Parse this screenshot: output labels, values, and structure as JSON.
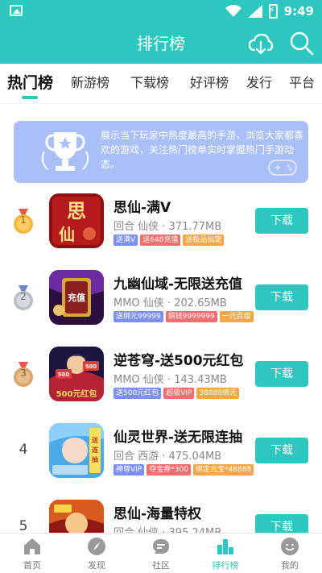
{
  "status_bar": {
    "time": "9:49"
  },
  "header": {
    "title": "排行榜"
  },
  "tabs": [
    {
      "label": "热门榜"
    },
    {
      "label": "新游榜"
    },
    {
      "label": "下载榜"
    },
    {
      "label": "好评榜"
    },
    {
      "label": "发行"
    },
    {
      "label": "平台"
    }
  ],
  "banner": {
    "text": "展示当下玩家中热度最高的手游，浏览大家都喜欢的游戏，关注热门榜单实时掌握热门手游动态。"
  },
  "apps": [
    {
      "rank": "1",
      "name": "思仙-满V",
      "meta": "回合 仙侠 · 371.77MB",
      "tags": [
        "送满V",
        "送648充值",
        "送极品仙宠"
      ],
      "button": "下载"
    },
    {
      "rank": "2",
      "name": "九幽仙域-无限送充值",
      "meta": "MMO 仙侠 · 202.65MB",
      "tags": [
        "送绑元99999",
        "铜钱9999999",
        "一元百级"
      ],
      "button": "下载"
    },
    {
      "rank": "3",
      "name": "逆苍穹-送500元红包",
      "meta": "MMO 仙侠 · 143.43MB",
      "tags": [
        "送500元红包",
        "超级VIP",
        "38888绑元"
      ],
      "button": "下载"
    },
    {
      "rank": "4",
      "name": "仙灵世界-送无限连抽",
      "meta": "回合 西游 · 475.04MB",
      "tags": [
        "神尊VIP",
        "夺宝券*300",
        "绑定元宝*48888"
      ],
      "button": "下载"
    },
    {
      "rank": "5",
      "name": "思仙-海量特权",
      "meta": "回合 仙侠 · 395.24MB",
      "tags": [],
      "button": "下载"
    }
  ],
  "bottom_nav": [
    {
      "label": "首页",
      "icon": "home-icon"
    },
    {
      "label": "发现",
      "icon": "compass-icon"
    },
    {
      "label": "社区",
      "icon": "community-icon"
    },
    {
      "label": "排行榜",
      "icon": "ranking-icon"
    },
    {
      "label": "我的",
      "icon": "profile-icon"
    }
  ],
  "colors": {
    "accent": "#2ec7c0",
    "banner": "#a9bff8"
  }
}
